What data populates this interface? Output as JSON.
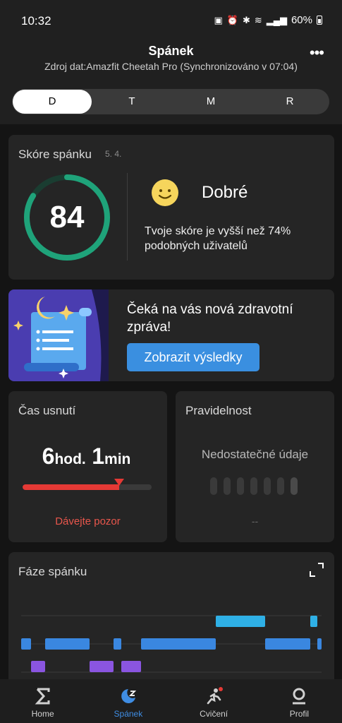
{
  "status_bar": {
    "time": "10:32",
    "battery": "60%"
  },
  "header": {
    "title": "Spánek",
    "subtitle": "Zdroj dat:Amazfit Cheetah Pro (Synchronizováno v 07:04)",
    "more_icon": "more-horizontal-icon"
  },
  "tabs": [
    {
      "label": "D",
      "active": true
    },
    {
      "label": "T",
      "active": false
    },
    {
      "label": "M",
      "active": false
    },
    {
      "label": "R",
      "active": false
    }
  ],
  "score_card": {
    "title": "Skóre spánku",
    "date": "5. 4.",
    "score": "84",
    "score_fraction": 0.84,
    "ring_color": "#1fa37a",
    "rating": "Dobré",
    "rating_icon": "smile-face-icon",
    "comparison": "Tvoje skóre je vyšší než 74% podobných uživatelů"
  },
  "promo": {
    "text": "Čeká na vás nová zdravotní zpráva!",
    "button": "Zobrazit výsledky",
    "image_icon": "moon-scroll-report-icon"
  },
  "fall_asleep": {
    "title": "Čas usnutí",
    "hours": "6",
    "hours_unit": "hod.",
    "minutes": "1",
    "minutes_unit": "min",
    "level_fraction": 0.75,
    "warning": "Dávejte pozor",
    "warning_color": "#e8564c"
  },
  "regularity": {
    "title": "Pravidelnost",
    "message": "Nedostatečné údaje",
    "placeholder": "--"
  },
  "phases": {
    "title": "Fáze spánku",
    "expand_icon": "expand-icon",
    "colors": {
      "awake": "#2fb0e6",
      "light": "#3a87e0",
      "deep": "#8a55e0"
    }
  },
  "bottom_nav": [
    {
      "label": "Home",
      "icon": "sigma-home-icon",
      "active": false
    },
    {
      "label": "Spánek",
      "icon": "moon-sleep-icon",
      "active": true
    },
    {
      "label": "Cvičení",
      "icon": "running-person-icon",
      "active": false
    },
    {
      "label": "Profil",
      "icon": "profile-icon",
      "active": false
    }
  ]
}
